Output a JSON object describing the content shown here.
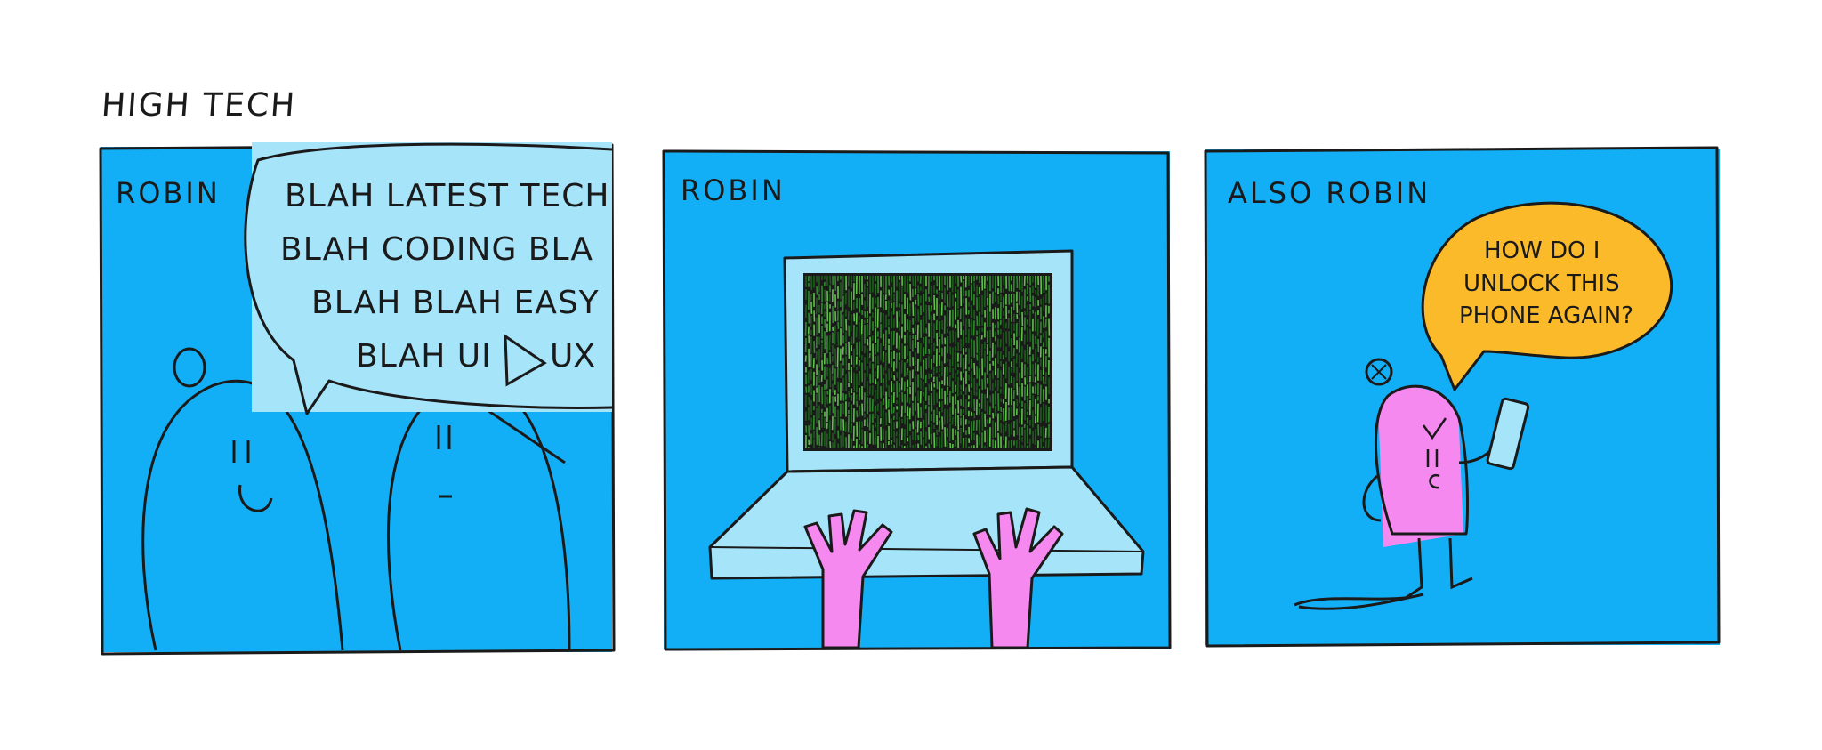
{
  "title": "HIGH TECH",
  "panel1": {
    "caption": "ROBIN",
    "speech": [
      "BLAH LATEST TECH",
      "BLAH CODING BLA",
      "BLAH BLAH EASY",
      "BLAH UI",
      "UX"
    ]
  },
  "panel2": {
    "caption": "ROBIN"
  },
  "panel3": {
    "caption": "ALSO ROBIN",
    "speech": [
      "HOW DO I",
      "UNLOCK THIS",
      "PHONE AGAIN?"
    ]
  },
  "colors": {
    "panel_blue": "#13aff6",
    "light_blue": "#a6e4fa",
    "pink": "#f689ef",
    "orange": "#fbba2a",
    "matrix_green": "#2e8a2c",
    "ink": "#1a1a1a"
  }
}
